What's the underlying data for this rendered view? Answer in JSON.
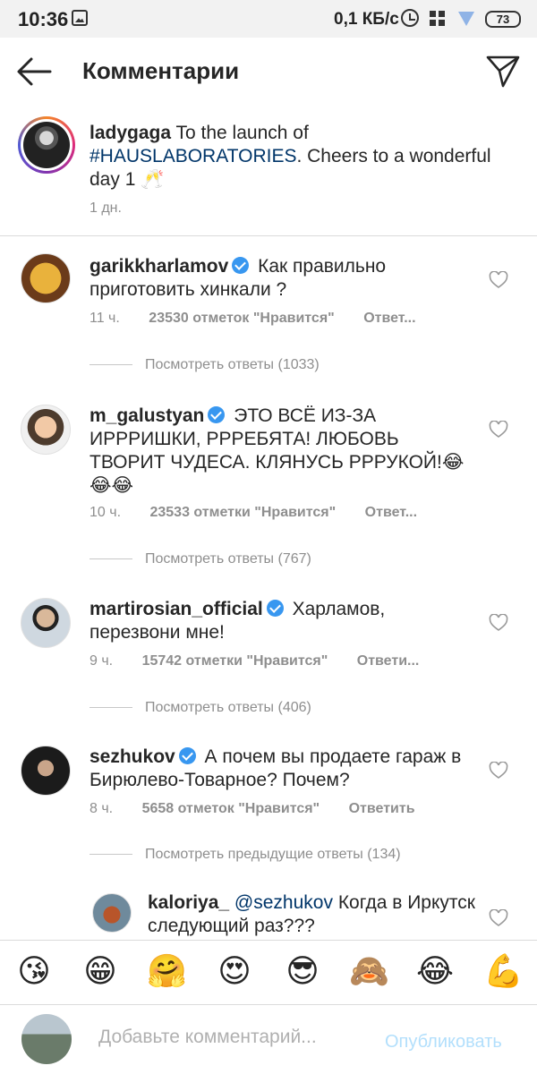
{
  "status_bar": {
    "time": "10:36",
    "speed": "0,1 КБ/с",
    "battery": "73"
  },
  "header": {
    "title": "Комментарии",
    "back_icon": "arrow-left-icon",
    "send_icon": "paper-plane-icon"
  },
  "caption": {
    "username": "ladygaga",
    "text_before": "To the launch of",
    "hashtag": "#HAUSLABORATORIES",
    "text_after": ". Cheers to a wonderful day 1 🥂",
    "time": "1 дн."
  },
  "comments": [
    {
      "username": "garikkharlamov",
      "text": "Как правильно приготовить хинкали ?",
      "time": "11 ч.",
      "likes": "23530 отметок \"Нравится\"",
      "reply": "Ответ...",
      "view_replies": "Посмотреть ответы (1033)"
    },
    {
      "username": "m_galustyan",
      "text": "ЭТО ВСЁ ИЗ-ЗА ИРРРИШКИ, РРРЕБЯТА! ЛЮБОВЬ ТВОРИТ ЧУДЕСА. КЛЯНУСЬ РРРУКОЙ!😂😂😂",
      "time": "10 ч.",
      "likes": "23533 отметки \"Нравится\"",
      "reply": "Ответ...",
      "view_replies": "Посмотреть ответы (767)"
    },
    {
      "username": "martirosian_official",
      "text": "Харламов, перезвони мне!",
      "time": "9 ч.",
      "likes": "15742 отметки \"Нравится\"",
      "reply": "Ответи...",
      "view_replies": "Посмотреть ответы (406)"
    },
    {
      "username": "sezhukov",
      "text": "А почем вы продаете гараж в Бирюлево-Товарное? Почем?",
      "time": "8 ч.",
      "likes": "5658 отметок \"Нравится\"",
      "reply": "Ответить",
      "view_replies": "Посмотреть предыдущие ответы (134)"
    }
  ],
  "reply": {
    "username": "kaloriya_",
    "mention": "@sezhukov",
    "text": "Когда в Иркутск следующий раз???"
  },
  "emojis": [
    "😘",
    "😁",
    "🤗",
    "😍",
    "😎",
    "🙈",
    "😂",
    "💪"
  ],
  "input": {
    "placeholder": "Добавьте комментарий...",
    "publish_label": "Опубликовать"
  },
  "colors": {
    "link": "#003569",
    "verified": "#3897f0",
    "muted": "#8e8e8e",
    "publish_disabled": "#b2dffc"
  }
}
